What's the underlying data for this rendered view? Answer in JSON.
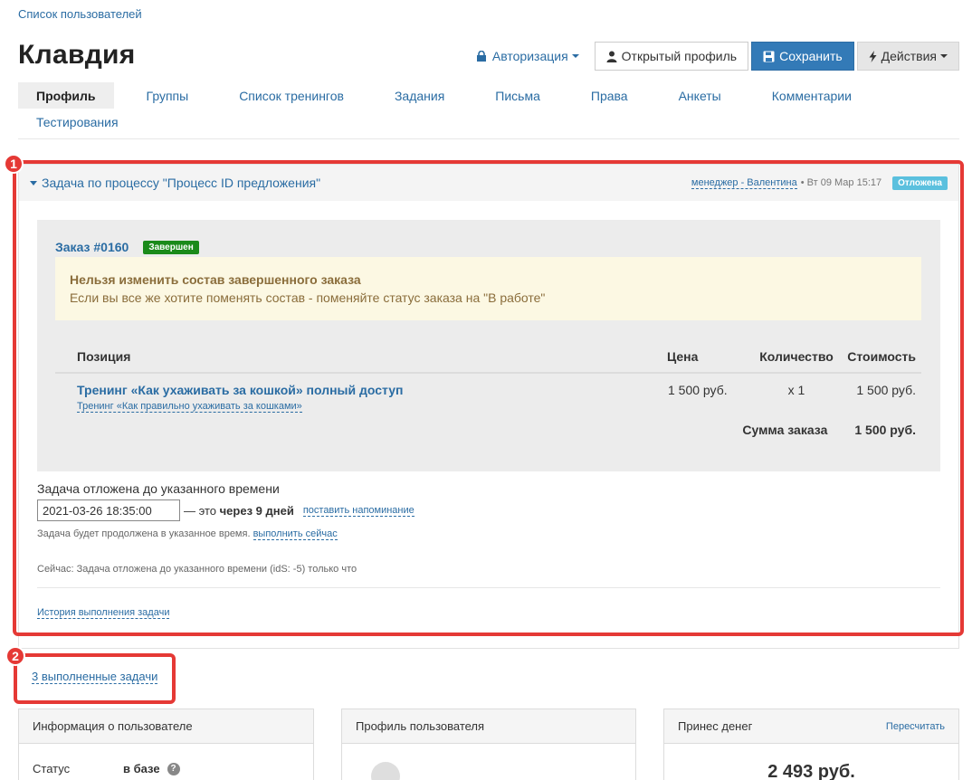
{
  "breadcrumb": "Список пользователей",
  "page_title": "Клавдия",
  "toolbar": {
    "auth_label": "Авторизация",
    "open_profile_label": "Открытый профиль",
    "save_label": "Сохранить",
    "actions_label": "Действия"
  },
  "tabs": [
    {
      "label": "Профиль",
      "active": true
    },
    {
      "label": "Группы"
    },
    {
      "label": "Список тренингов"
    },
    {
      "label": "Задания"
    },
    {
      "label": "Письма"
    },
    {
      "label": "Права"
    },
    {
      "label": "Анкеты"
    },
    {
      "label": "Комментарии"
    },
    {
      "label": "Тестирования"
    }
  ],
  "annotations": {
    "first": "1",
    "second": "2"
  },
  "task": {
    "title": "Задача по процессу \"Процесс ID предложения\"",
    "manager": "менеджер - Валентина",
    "datetime": "• Вт 09 Мар 15:17",
    "status": "Отложена",
    "order": {
      "number": "Заказ #0160",
      "status": "Завершен",
      "alert_title": "Нельзя изменить состав завершенного заказа",
      "alert_text": "Если вы все же хотите поменять состав - поменяйте статус заказа на \"В работе\"",
      "columns": {
        "position": "Позиция",
        "price": "Цена",
        "qty": "Количество",
        "total": "Стоимость"
      },
      "items": [
        {
          "name": "Тренинг «Как ухаживать за кошкой» полный доступ",
          "sub": "Тренинг «Как правильно ухаживать за кошками»",
          "price": "1 500 руб.",
          "qty": "x 1",
          "total": "1 500 руб."
        }
      ],
      "sum_label": "Сумма заказа",
      "sum_value": "1 500 руб."
    },
    "postpone_label": "Задача отложена до указанного времени",
    "postpone_date": "2021-03-26 18:35:00",
    "relative_prefix": "— это",
    "relative_value": "через 9 дней",
    "remind_link": "поставить напоминание",
    "continue_note": "Задача будет продолжена в указанное время.",
    "run_now_link": "выполнить сейчас",
    "now_note": "Сейчас: Задача отложена до указанного времени (idS: -5) только что",
    "history_link": "История выполнения задачи"
  },
  "done_tasks_link": "3 выполненные задачи",
  "panels": {
    "user_info": {
      "title": "Информация о пользователе",
      "status_key": "Статус",
      "status_value": "в базе",
      "help_icon": "?"
    },
    "user_profile": {
      "title": "Профиль пользователя"
    },
    "revenue": {
      "title": "Принес денег",
      "recalc": "Пересчитать",
      "amount": "2 493 руб."
    }
  },
  "colors": {
    "link": "#2a6ca3",
    "primary": "#337ab7",
    "annotation": "#e53935",
    "success": "#1a8a1a",
    "info": "#5bc0de"
  }
}
